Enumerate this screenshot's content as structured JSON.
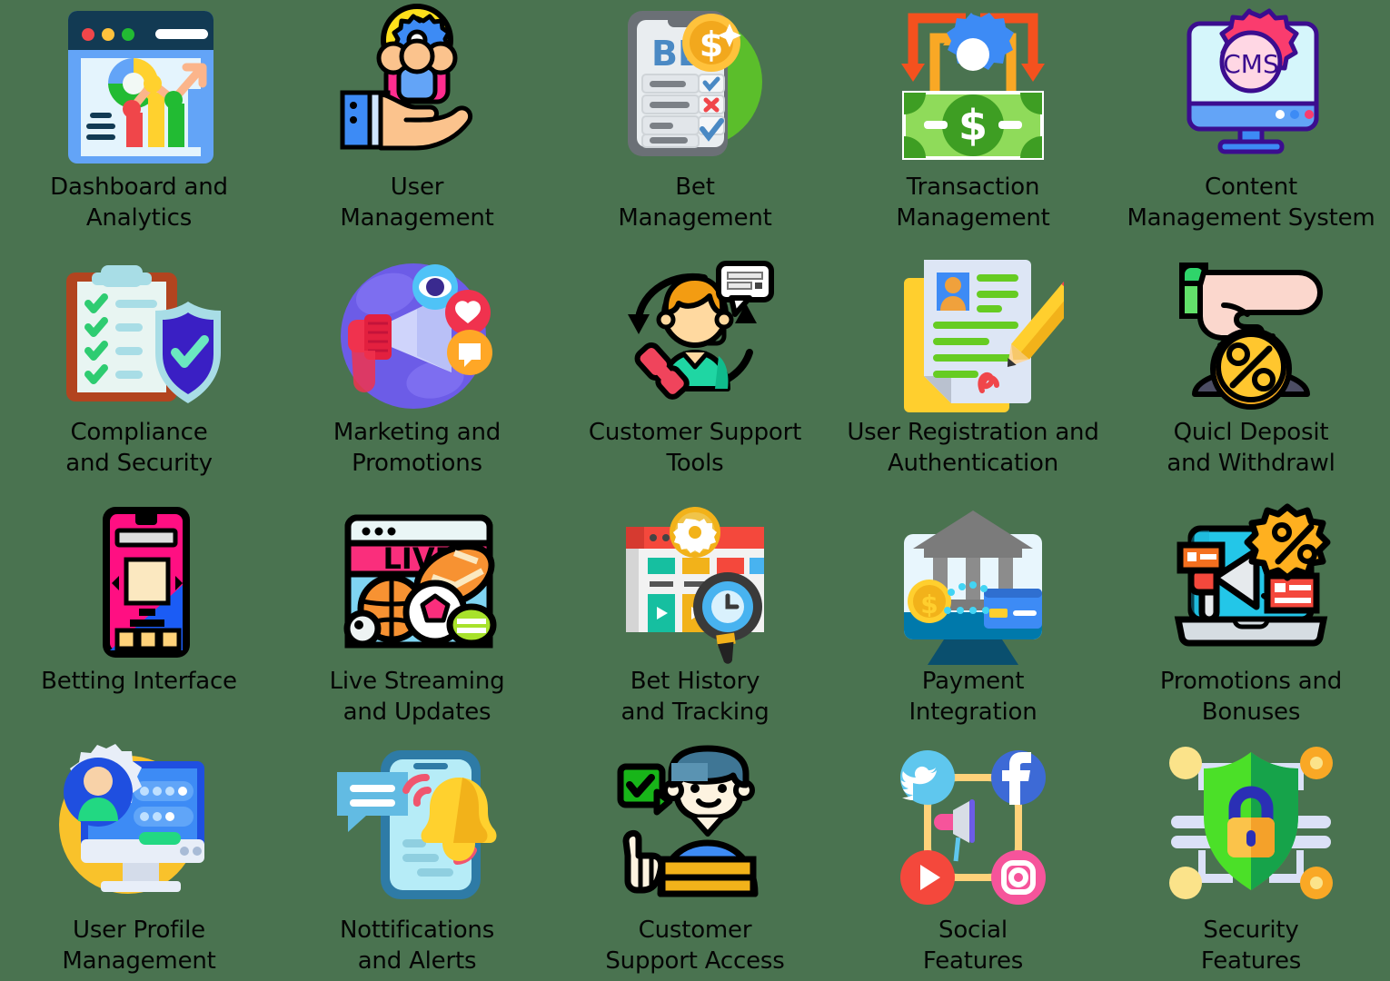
{
  "page": {
    "background_color": "#4a7350",
    "text_color": "#050505",
    "columns": 5,
    "rows": 4
  },
  "tiles": [
    {
      "id": "dashboard-and-analytics",
      "icon": "dashboard-chart-window-icon",
      "label": "Dashboard and\nAnalytics",
      "colors": [
        "#2196f3",
        "#123a53",
        "#ffd12e",
        "#f44336",
        "#22bb33",
        "#ffb48a"
      ]
    },
    {
      "id": "user-management",
      "icon": "hand-holding-users-gear-icon",
      "label": "User\nManagement",
      "colors": [
        "#ffe01b",
        "#3d8bf5",
        "#ff2d8f",
        "#fbc38d"
      ]
    },
    {
      "id": "bet-management",
      "icon": "bet-checklist-coin-icon",
      "label": "Bet\nManagement",
      "colors": [
        "#5bbe2b",
        "#e9edf0",
        "#ffc23c",
        "#4a89c4",
        "#f0464a"
      ]
    },
    {
      "id": "transaction-management",
      "icon": "transaction-arrows-banknote-gear-icon",
      "label": "Transaction\nManagement",
      "colors": [
        "#f4511e",
        "#f9a825",
        "#3d8bf5",
        "#8fdb5a",
        "#3e9e23"
      ]
    },
    {
      "id": "content-management-system",
      "icon": "cms-monitor-gear-icon",
      "label": "Content\nManagement System",
      "colors": [
        "#fa3c6e",
        "#ffd7e4",
        "#3b0d8f",
        "#d5f6fb",
        "#3d8bf5"
      ],
      "badge_text": "CMS"
    },
    {
      "id": "compliance-and-security",
      "icon": "clipboard-shield-check-icon",
      "label": "Compliance\nand Security",
      "colors": [
        "#b2441f",
        "#e8f5f2",
        "#2ecc71",
        "#3a1fc4",
        "#a8dde6"
      ]
    },
    {
      "id": "marketing-and-promotions",
      "icon": "megaphone-social-reactions-icon",
      "label": "Marketing and\nPromotions",
      "colors": [
        "#6c5ce7",
        "#cfd4fb",
        "#f0324e",
        "#ffa726",
        "#4fc3f7"
      ]
    },
    {
      "id": "customer-support-tools",
      "icon": "support-agent-headset-phone-icon",
      "label": "Customer Support\nTools",
      "colors": [
        "#f39c12",
        "#ffd9a0",
        "#1fd6a3",
        "#f0445c",
        "#000000"
      ]
    },
    {
      "id": "user-registration-and-authentication",
      "icon": "id-document-pencil-signature-icon",
      "label": "User Registration and\nAuthentication",
      "colors": [
        "#ffcf2e",
        "#dde6f5",
        "#3d8bf5",
        "#66cc22",
        "#f0464a"
      ]
    },
    {
      "id": "quick-deposit-and-withdrawal",
      "icon": "hand-pointing-coin-percent-icon",
      "label": "Quicl Deposit\nand Withdrawl",
      "colors": [
        "#fbd7cd",
        "#62e06a",
        "#ffc62e",
        "#4c4d63",
        "#000000"
      ]
    },
    {
      "id": "betting-interface",
      "icon": "mobile-betting-screen-icon",
      "label": "Betting  Interface",
      "colors": [
        "#ff0f82",
        "#1b5cf5",
        "#fbe8c0",
        "#ffd27a",
        "#000000"
      ]
    },
    {
      "id": "live-streaming-and-updates",
      "icon": "live-browser-sports-balls-icon",
      "label": "Live Streaming\nand Updates",
      "colors": [
        "#fa2e7c",
        "#7fd4f2",
        "#f79232",
        "#ffffff",
        "#a8e22b"
      ],
      "badge_text": "LIVE"
    },
    {
      "id": "bet-history-and-tracking",
      "icon": "history-window-magnifier-clock-icon",
      "label": "Bet History\nand Tracking",
      "colors": [
        "#f4483c",
        "#f2b21a",
        "#16bfa0",
        "#48b3f0",
        "#ededed"
      ]
    },
    {
      "id": "payment-integration",
      "icon": "bank-monitor-card-coin-icon",
      "label": "Payment\nIntegration",
      "colors": [
        "#7b7b7b",
        "#e8f6fd",
        "#0079ab",
        "#ffcf2e",
        "#3d8bf5"
      ]
    },
    {
      "id": "promotions-and-bonuses",
      "icon": "laptop-megaphone-discount-icon",
      "label": "Promotions and\nBonuses",
      "colors": [
        "#23c6e8",
        "#ffb01f",
        "#f4483c",
        "#f4701f",
        "#d6dde2"
      ]
    },
    {
      "id": "user-profile-management",
      "icon": "profile-monitor-gear-icon",
      "label": "User Profile\nManagement",
      "colors": [
        "#f9c22b",
        "#1f4fe0",
        "#3d8bf5",
        "#22d882",
        "#e8eef8"
      ]
    },
    {
      "id": "notifications-and-alerts",
      "icon": "phone-bell-chat-icon",
      "label": "Nottifications\nand Alerts",
      "colors": [
        "#2e7ba6",
        "#b6ecf7",
        "#ffd12e",
        "#f0566f",
        "#62bbe3"
      ]
    },
    {
      "id": "customer-support-access",
      "icon": "support-person-thumbsup-check-icon",
      "label": "Customer\nSupport Access",
      "colors": [
        "#3f7695",
        "#fdf3e0",
        "#3d8bf5",
        "#f2b21a",
        "#18b519"
      ]
    },
    {
      "id": "social-features",
      "icon": "social-network-megaphone-icon",
      "label": "Social\nFeatures",
      "colors": [
        "#5fc7ee",
        "#3d6ad6",
        "#f4483c",
        "#f6549b",
        "#ffd27a"
      ]
    },
    {
      "id": "security-features",
      "icon": "shield-lock-network-icon",
      "label": "Security\nFeatures",
      "colors": [
        "#4be028",
        "#16a34a",
        "#f9a825",
        "#fbe38a",
        "#2a2fb5"
      ]
    }
  ]
}
